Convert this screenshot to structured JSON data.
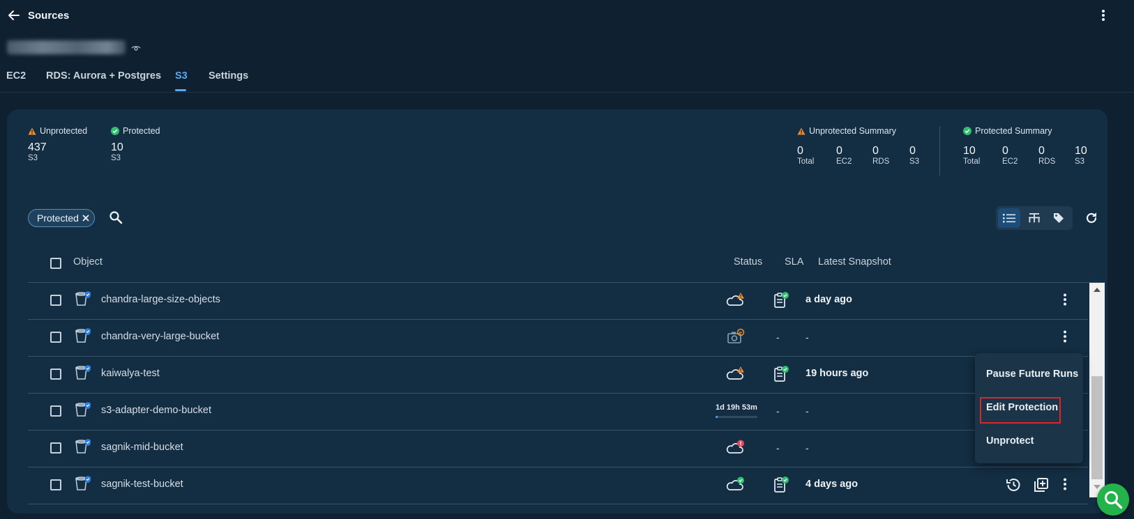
{
  "header": {
    "back_label": "Sources"
  },
  "tabs": [
    {
      "label": "EC2"
    },
    {
      "label": "RDS: Aurora + Postgres"
    },
    {
      "label": "S3"
    },
    {
      "label": "Settings"
    }
  ],
  "stats": {
    "unprotected": {
      "label": "Unprotected",
      "value": "437",
      "sub": "S3"
    },
    "protected": {
      "label": "Protected",
      "value": "10",
      "sub": "S3"
    },
    "unprotected_summary": {
      "label": "Unprotected Summary",
      "items": [
        {
          "value": "0",
          "sub": "Total"
        },
        {
          "value": "0",
          "sub": "EC2"
        },
        {
          "value": "0",
          "sub": "RDS"
        },
        {
          "value": "0",
          "sub": "S3"
        }
      ]
    },
    "protected_summary": {
      "label": "Protected Summary",
      "items": [
        {
          "value": "10",
          "sub": "Total"
        },
        {
          "value": "0",
          "sub": "EC2"
        },
        {
          "value": "0",
          "sub": "RDS"
        },
        {
          "value": "10",
          "sub": "S3"
        }
      ]
    }
  },
  "filter": {
    "chip_label": "Protected"
  },
  "table": {
    "headers": {
      "object": "Object",
      "status": "Status",
      "sla": "SLA",
      "latest_snapshot": "Latest Snapshot"
    },
    "rows": [
      {
        "name": "chandra-large-size-objects",
        "status": "cloud-warning",
        "sla": "sla-ok",
        "snapshot": "a day ago"
      },
      {
        "name": "chandra-very-large-bucket",
        "status": "camera-pending",
        "sla": "-",
        "snapshot": "-"
      },
      {
        "name": "kaiwalya-test",
        "status": "cloud-warning",
        "sla": "sla-ok",
        "snapshot": "19 hours ago"
      },
      {
        "name": "s3-adapter-demo-bucket",
        "status": "running",
        "timer": "1d 19h 53m",
        "progress": 0.05,
        "sla": "-",
        "snapshot": "-"
      },
      {
        "name": "sagnik-mid-bucket",
        "status": "cloud-error",
        "sla": "-",
        "snapshot": "-"
      },
      {
        "name": "sagnik-test-bucket",
        "status": "cloud-ok",
        "sla": "sla-ok",
        "snapshot": "4 days ago"
      }
    ]
  },
  "context_menu": {
    "items": [
      {
        "label": "Pause Future Runs"
      },
      {
        "label": "Edit Protection"
      },
      {
        "label": "Unprotect"
      }
    ]
  },
  "colors": {
    "background": "#0f2030",
    "panel": "#132d42",
    "accent": "#5ba8ee",
    "success": "#2fbf71",
    "warning": "#f08c2e",
    "error": "#e04a5a",
    "highlight": "#e02424",
    "help": "#24b34a"
  }
}
